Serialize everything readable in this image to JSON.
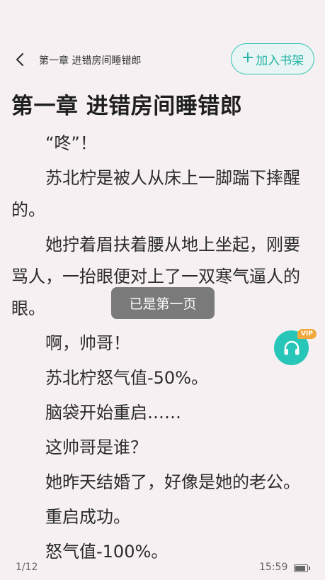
{
  "header": {
    "chapter_name": "第一章 进错房间睡错郎",
    "add_shelf_label": "加入书架",
    "add_shelf_plus": "+"
  },
  "chapter": {
    "title": "第一章 进错房间睡错郎",
    "paragraphs": [
      "“咚”！",
      "苏北柠是被人从床上一脚踹下摔醒的。",
      "她拧着眉扶着腰从地上坐起，刚要骂人，一抬眼便对上了一双寒气逼人的眼。",
      "啊，帅哥！",
      "苏北柠怒气值-50%。",
      "脑袋开始重启……",
      "这帅哥是谁？",
      "她昨天结婚了，好像是她的老公。",
      "重启成功。",
      "怒气值-100%。"
    ]
  },
  "toast": {
    "text": "已是第一页"
  },
  "audio": {
    "badge": "VIP",
    "icon": "headphones-icon"
  },
  "footer": {
    "page": "1/12",
    "time": "15:59",
    "battery_level": 0.85
  },
  "colors": {
    "accent": "#27c6b9",
    "background": "#f6f0f3",
    "vip": "#f2a93b"
  }
}
